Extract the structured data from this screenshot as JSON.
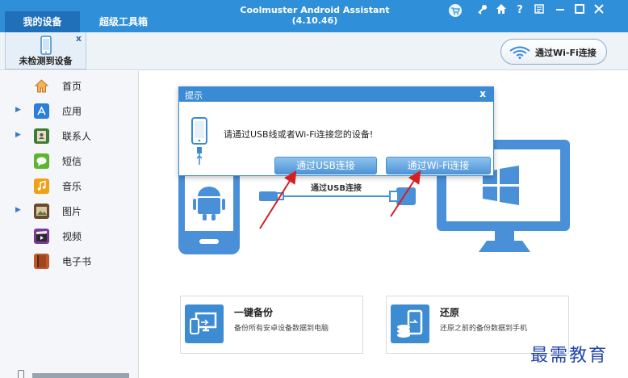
{
  "titlebar": {
    "title": "Coolmuster Android Assistant (4.10.46)",
    "tabs": [
      {
        "label": "我的设备"
      },
      {
        "label": "超级工具箱"
      }
    ],
    "icons": [
      "cart-icon",
      "key-icon",
      "home-icon",
      "help-icon",
      "feedback-icon",
      "minimize-icon",
      "maximize-icon",
      "close-icon"
    ],
    "help_glyph": "?"
  },
  "device": {
    "label": "未检测到设备",
    "close_glyph": "x"
  },
  "wifi_button": {
    "label": "通过Wi-Fi连接"
  },
  "sidebar": {
    "items": [
      {
        "label": "首页",
        "icon": "home-icon",
        "expandable": false,
        "color": "#e9a23b"
      },
      {
        "label": "应用",
        "icon": "app-store-icon",
        "expandable": true,
        "color": "#2b7fd6"
      },
      {
        "label": "联系人",
        "icon": "contacts-book-icon",
        "expandable": true,
        "color": "#3a7d3a"
      },
      {
        "label": "短信",
        "icon": "sms-icon",
        "expandable": false,
        "color": "#5cb531"
      },
      {
        "label": "音乐",
        "icon": "music-icon",
        "expandable": false,
        "color": "#f0a014"
      },
      {
        "label": "图片",
        "icon": "photo-icon",
        "expandable": true,
        "color": "#6b4a2c"
      },
      {
        "label": "视频",
        "icon": "video-icon",
        "expandable": false,
        "color": "#7a3a9a"
      },
      {
        "label": "电子书",
        "icon": "ebook-icon",
        "expandable": false,
        "color": "#c0582a"
      }
    ]
  },
  "main": {
    "usb_label": "通过USB连接",
    "cards": [
      {
        "title": "一键备份",
        "desc": "备份所有安卓设备数据到电脑",
        "icon": "backup-to-pc-icon"
      },
      {
        "title": "还原",
        "desc": "还原之前的备份数据到手机",
        "icon": "restore-to-phone-icon"
      }
    ]
  },
  "dialog": {
    "title": "提示",
    "close_glyph": "x",
    "message": "请通过USB线或者Wi-Fi连接您的设备!",
    "buttons": {
      "usb": "通过USB连接",
      "wifi": "通过Wi-Fi连接"
    }
  },
  "watermark": "最需教育",
  "colors": {
    "accent": "#2f8fd8",
    "illustration": "#4a90d9",
    "arrow": "#d42020"
  }
}
